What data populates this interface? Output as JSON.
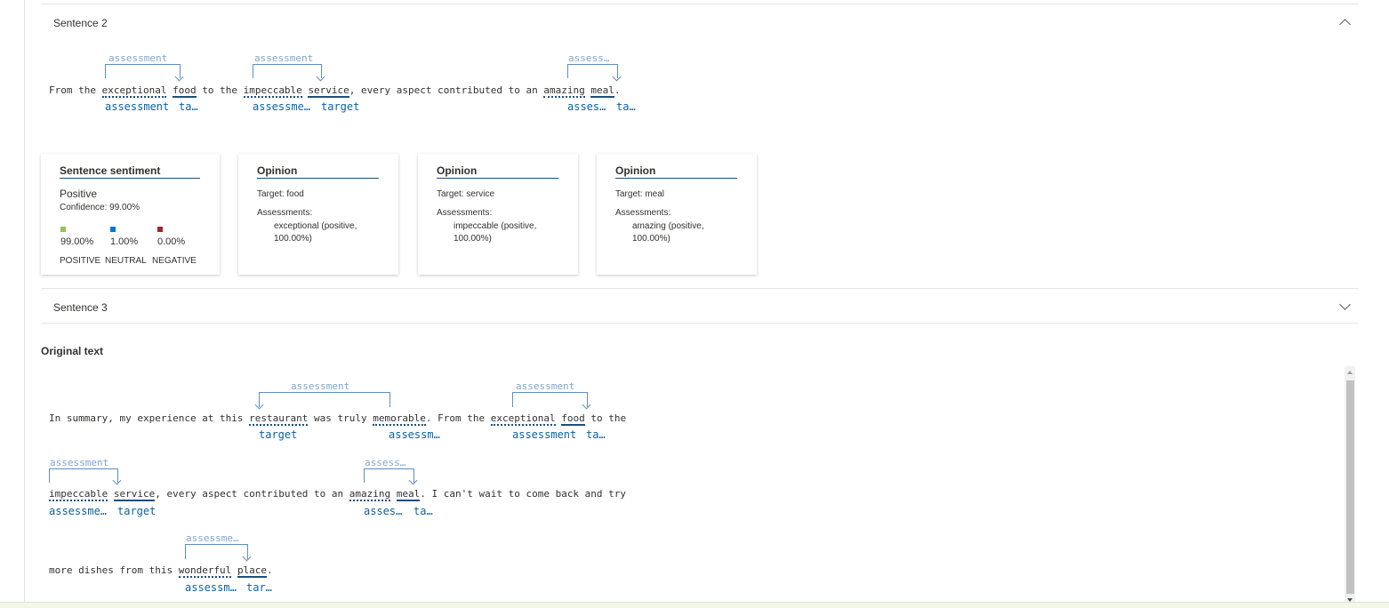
{
  "sentence2": {
    "title": "Sentence 2",
    "text_parts": [
      "From the ",
      "exceptional",
      " ",
      "food",
      " to the ",
      "impeccable",
      " ",
      "service",
      ", every aspect contributed to an ",
      "amazing",
      " ",
      "meal",
      "."
    ],
    "labels_over": [
      "assessment",
      "assessment",
      "assess…"
    ],
    "labels_under": [
      "assessment",
      "ta…",
      "assessme…",
      "target",
      "asses…",
      "ta…"
    ]
  },
  "sentiment_card": {
    "title": "Sentence sentiment",
    "label": "Positive",
    "confidence": "Confidence: 99.00%",
    "scores": [
      {
        "value": "99.00%",
        "name": "POSITIVE",
        "color": "#92c353"
      },
      {
        "value": "1.00%",
        "name": "NEUTRAL",
        "color": "#0078d4"
      },
      {
        "value": "0.00%",
        "name": "NEGATIVE",
        "color": "#a4262c"
      }
    ]
  },
  "opinions": [
    {
      "title": "Opinion",
      "target": "Target: food",
      "assess_label": "Assessments:",
      "assessment": "exceptional (positive,",
      "assessment2": "100.00%)"
    },
    {
      "title": "Opinion",
      "target": "Target: service",
      "assess_label": "Assessments:",
      "assessment": "impeccable (positive,",
      "assessment2": "100.00%)"
    },
    {
      "title": "Opinion",
      "target": "Target: meal",
      "assess_label": "Assessments:",
      "assessment": "amazing (positive,",
      "assessment2": "100.00%)"
    }
  ],
  "sentence3": {
    "title": "Sentence 3"
  },
  "original": {
    "title": "Original text",
    "line1_parts": [
      "In summary, my experience at this ",
      "restaurant",
      " was truly ",
      "memorable",
      ". From the ",
      "exceptional",
      " ",
      "food",
      " to the"
    ],
    "line2_parts": [
      "impeccable",
      " ",
      "service",
      ", every aspect contributed to an ",
      "amazing",
      " ",
      "meal",
      ". I can't wait to come back and try"
    ],
    "line3_parts": [
      "more dishes from this ",
      "wonderful",
      " ",
      "place",
      "."
    ],
    "l1_over": [
      "assessment",
      "assessment"
    ],
    "l1_under": [
      "target",
      "assessm…",
      "assessment",
      "ta…"
    ],
    "l2_over": [
      "assessment",
      "assess…"
    ],
    "l2_under": [
      "assessme…",
      "target",
      "asses…",
      "ta…"
    ],
    "l3_over": [
      "assessme…"
    ],
    "l3_under": [
      "assessm…",
      "tar…"
    ]
  }
}
